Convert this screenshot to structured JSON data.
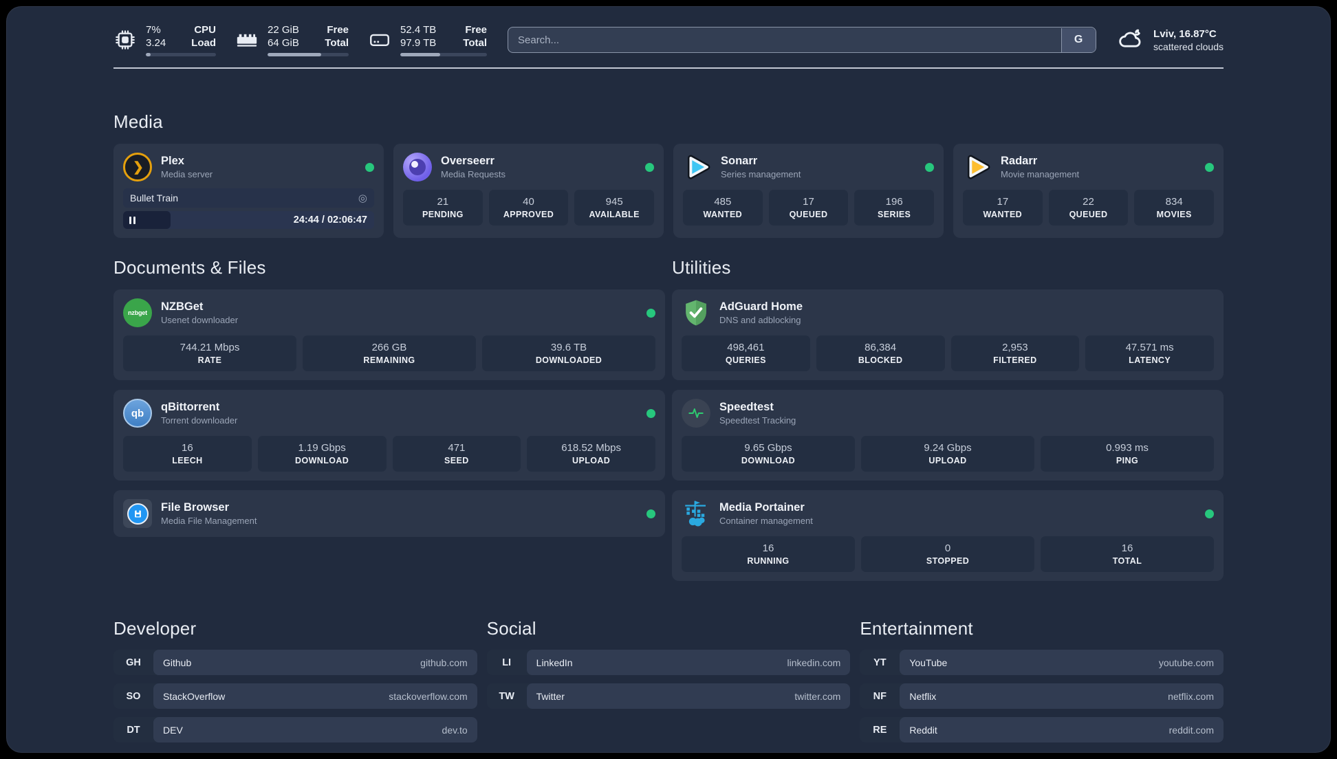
{
  "colors": {
    "status_online": "#27c77d",
    "plex_accent": "#e5a00d"
  },
  "header": {
    "cpu": {
      "values": [
        "7%",
        "3.24"
      ],
      "labels": [
        "CPU",
        "Load"
      ],
      "progress": 7
    },
    "ram": {
      "values": [
        "22 GiB",
        "64 GiB"
      ],
      "labels": [
        "Free",
        "Total"
      ],
      "progress": 66
    },
    "disk": {
      "values": [
        "52.4 TB",
        "97.9 TB"
      ],
      "labels": [
        "Free",
        "Total"
      ],
      "progress": 46
    },
    "search": {
      "placeholder": "Search...",
      "provider_button": "G"
    },
    "weather": {
      "location": "Lviv, 16.87°C",
      "condition": "scattered clouds"
    }
  },
  "media": {
    "section_title": "Media",
    "plex": {
      "name": "Plex",
      "subtitle": "Media server",
      "player": {
        "title": "Bullet Train",
        "time_display": "24:44 / 02:06:47",
        "progress": 19
      }
    },
    "overseerr": {
      "name": "Overseerr",
      "subtitle": "Media Requests",
      "stats": [
        {
          "value": "21",
          "label": "PENDING"
        },
        {
          "value": "40",
          "label": "APPROVED"
        },
        {
          "value": "945",
          "label": "AVAILABLE"
        }
      ]
    },
    "sonarr": {
      "name": "Sonarr",
      "subtitle": "Series management",
      "stats": [
        {
          "value": "485",
          "label": "WANTED"
        },
        {
          "value": "17",
          "label": "QUEUED"
        },
        {
          "value": "196",
          "label": "SERIES"
        }
      ]
    },
    "radarr": {
      "name": "Radarr",
      "subtitle": "Movie management",
      "stats": [
        {
          "value": "17",
          "label": "WANTED"
        },
        {
          "value": "22",
          "label": "QUEUED"
        },
        {
          "value": "834",
          "label": "MOVIES"
        }
      ]
    }
  },
  "documents": {
    "section_title": "Documents & Files",
    "nzbget": {
      "name": "NZBGet",
      "subtitle": "Usenet downloader",
      "icon_label": "nzbget",
      "stats": [
        {
          "value": "744.21 Mbps",
          "label": "RATE"
        },
        {
          "value": "266 GB",
          "label": "REMAINING"
        },
        {
          "value": "39.6 TB",
          "label": "DOWNLOADED"
        }
      ]
    },
    "qbittorrent": {
      "name": "qBittorrent",
      "subtitle": "Torrent downloader",
      "icon_label": "qb",
      "stats": [
        {
          "value": "16",
          "label": "LEECH"
        },
        {
          "value": "1.19 Gbps",
          "label": "DOWNLOAD"
        },
        {
          "value": "471",
          "label": "SEED"
        },
        {
          "value": "618.52 Mbps",
          "label": "UPLOAD"
        }
      ]
    },
    "filebrowser": {
      "name": "File Browser",
      "subtitle": "Media File Management"
    }
  },
  "utilities": {
    "section_title": "Utilities",
    "adguard": {
      "name": "AdGuard Home",
      "subtitle": "DNS and adblocking",
      "stats": [
        {
          "value": "498,461",
          "label": "QUERIES"
        },
        {
          "value": "86,384",
          "label": "BLOCKED"
        },
        {
          "value": "2,953",
          "label": "FILTERED"
        },
        {
          "value": "47.571 ms",
          "label": "LATENCY"
        }
      ]
    },
    "speedtest": {
      "name": "Speedtest",
      "subtitle": "Speedtest Tracking",
      "stats": [
        {
          "value": "9.65 Gbps",
          "label": "DOWNLOAD"
        },
        {
          "value": "9.24 Gbps",
          "label": "UPLOAD"
        },
        {
          "value": "0.993 ms",
          "label": "PING"
        }
      ]
    },
    "portainer": {
      "name": "Media Portainer",
      "subtitle": "Container management",
      "stats": [
        {
          "value": "16",
          "label": "RUNNING"
        },
        {
          "value": "0",
          "label": "STOPPED"
        },
        {
          "value": "16",
          "label": "TOTAL"
        }
      ]
    }
  },
  "bookmarks": {
    "developer": {
      "title": "Developer",
      "items": [
        {
          "abbr": "GH",
          "name": "Github",
          "url": "github.com"
        },
        {
          "abbr": "SO",
          "name": "StackOverflow",
          "url": "stackoverflow.com"
        },
        {
          "abbr": "DT",
          "name": "DEV",
          "url": "dev.to"
        }
      ]
    },
    "social": {
      "title": "Social",
      "items": [
        {
          "abbr": "LI",
          "name": "LinkedIn",
          "url": "linkedin.com"
        },
        {
          "abbr": "TW",
          "name": "Twitter",
          "url": "twitter.com"
        }
      ]
    },
    "entertainment": {
      "title": "Entertainment",
      "items": [
        {
          "abbr": "YT",
          "name": "YouTube",
          "url": "youtube.com"
        },
        {
          "abbr": "NF",
          "name": "Netflix",
          "url": "netflix.com"
        },
        {
          "abbr": "RE",
          "name": "Reddit",
          "url": "reddit.com"
        }
      ]
    }
  }
}
